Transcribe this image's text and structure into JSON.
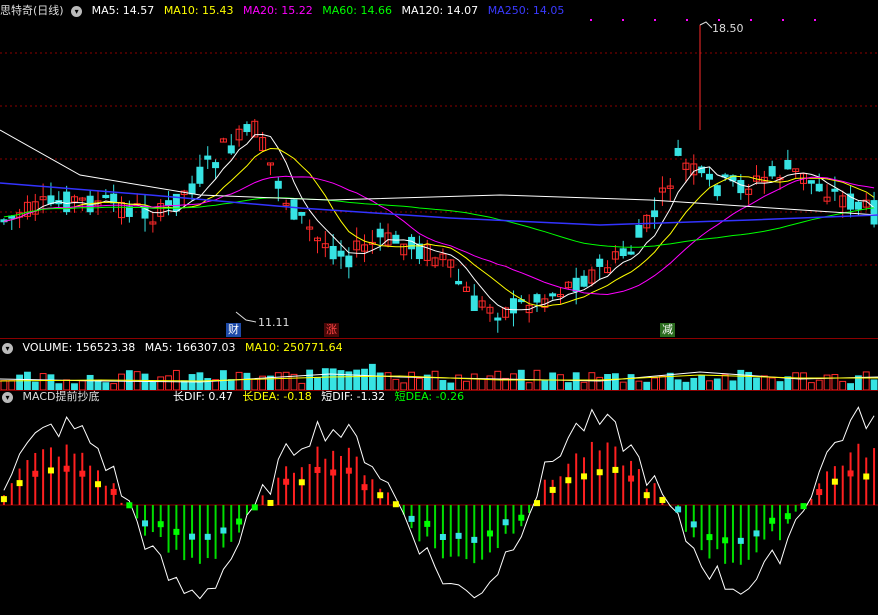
{
  "price_pane": {
    "title": "思特奇(日线)",
    "ma": [
      {
        "label": "MA5: 14.57",
        "color": "#ffffff"
      },
      {
        "label": "MA10: 15.43",
        "color": "#ffff00"
      },
      {
        "label": "MA20: 15.22",
        "color": "#ff00ff"
      },
      {
        "label": "MA60: 14.66",
        "color": "#00ff00"
      },
      {
        "label": "MA120: 14.07",
        "color": "#ffffff"
      },
      {
        "label": "MA250: 14.05",
        "color": "#3333ff"
      }
    ],
    "high_label": "18.50",
    "low_label": "11.11",
    "markers": [
      {
        "label": "财",
        "bg": "#1e4aa8",
        "color": "#ffffff"
      },
      {
        "label": "涨",
        "bg": "#5a0a0a",
        "color": "#ff4444"
      },
      {
        "label": "减",
        "bg": "#2a6b1e",
        "color": "#ffffff"
      }
    ]
  },
  "volume_pane": {
    "items": [
      {
        "label": "VOLUME: 156523.38",
        "color": "#ffffff"
      },
      {
        "label": "MA5: 166307.03",
        "color": "#ffffff"
      },
      {
        "label": "MA10: 250771.64",
        "color": "#ffff00"
      }
    ]
  },
  "macd_pane": {
    "title": "MACD提前抄底",
    "items": [
      {
        "label": "长DIF: 0.47",
        "color": "#ffffff"
      },
      {
        "label": "长DEA: -0.18",
        "color": "#ffff00"
      },
      {
        "label": "短DIF: -1.32",
        "color": "#ffffff"
      },
      {
        "label": "短DEA: -0.26",
        "color": "#00ff00"
      }
    ]
  },
  "colors": {
    "up": "#ff2a2a",
    "down": "#37e3e3",
    "grid": "#8b0000",
    "macd_pos": "#ff2020",
    "macd_neg": "#00dd00"
  }
}
